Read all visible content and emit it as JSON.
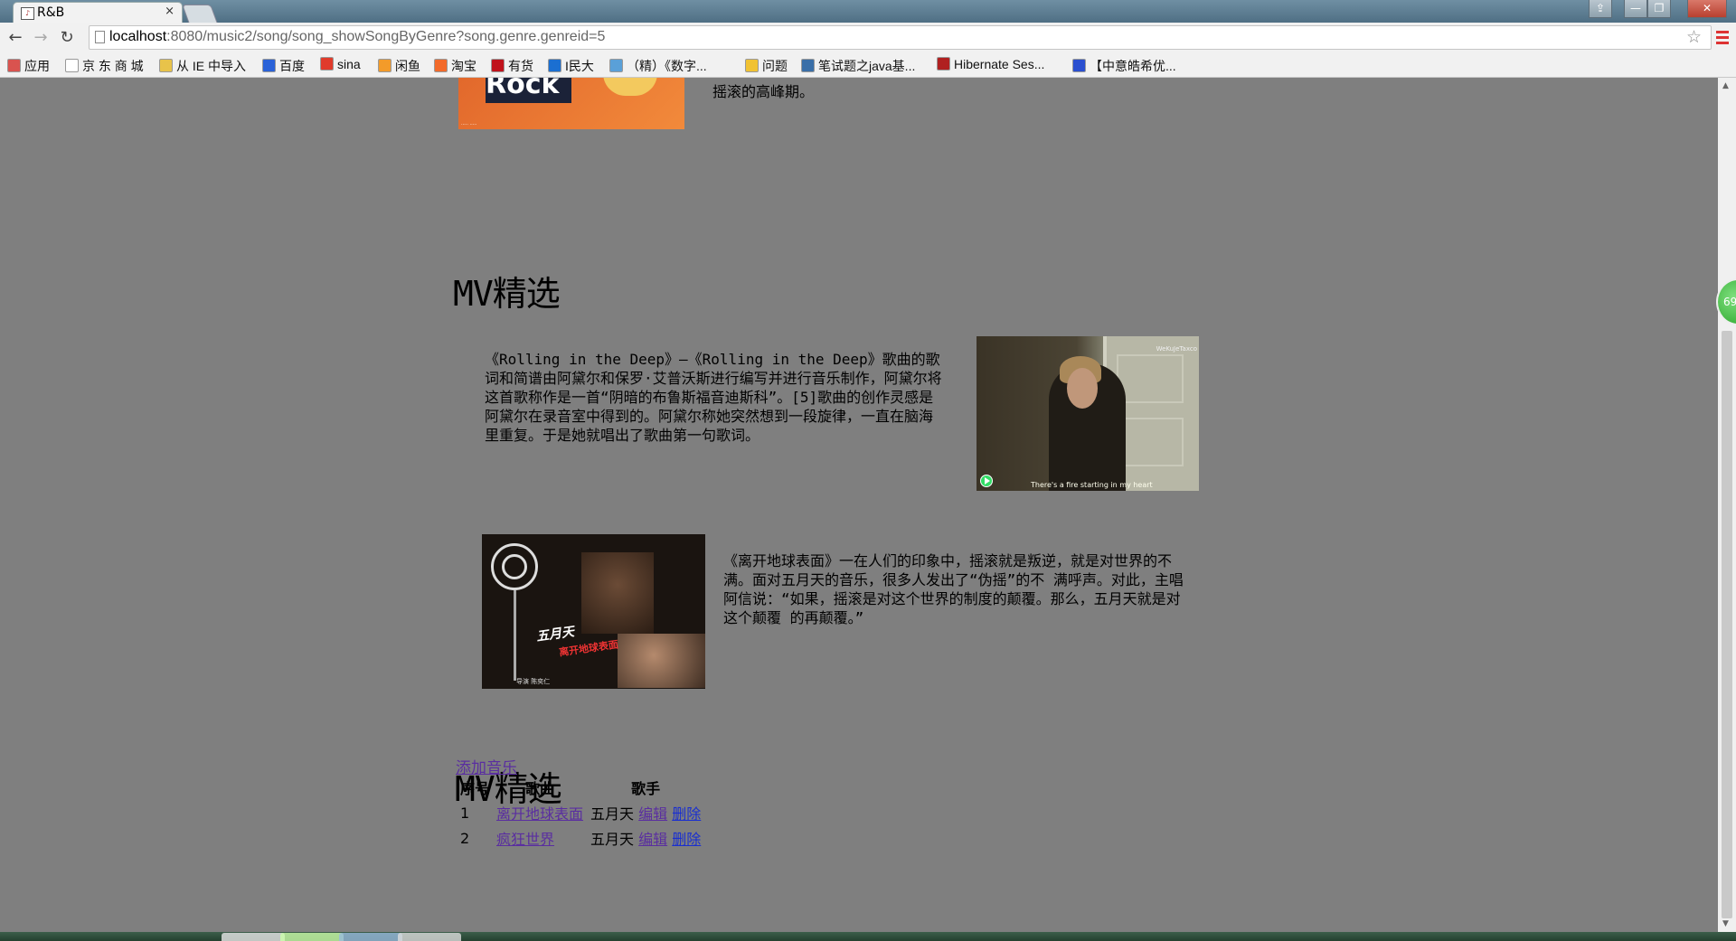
{
  "browser": {
    "tab_title": "R&B",
    "tab_close": "×",
    "url_host": "localhost",
    "url_rest": ":8080/music2/song/song_showSongByGenre?song.genre.genreid=5",
    "back": "←",
    "forward": "→",
    "reload": "↻",
    "star": "☆",
    "win_buttons": [
      "⇪",
      "—",
      "❐",
      "✕"
    ]
  },
  "bookmarks": [
    {
      "label": "应用",
      "icon": "apps-icon",
      "color": "#d9534f"
    },
    {
      "label": "京 东 商 城",
      "icon": "page-icon",
      "color": "#ffffff"
    },
    {
      "label": "从 IE 中导入",
      "icon": "folder-icon",
      "color": "#e8c34a"
    },
    {
      "label": "百度",
      "icon": "baidu-icon",
      "color": "#2a62d8"
    },
    {
      "label": "sina",
      "icon": "weibo-icon",
      "color": "#e03b2b"
    },
    {
      "label": "闲鱼",
      "icon": "xianyu-icon",
      "color": "#f39b2a"
    },
    {
      "label": "淘宝",
      "icon": "taobao-icon",
      "color": "#f36a2a"
    },
    {
      "label": "有货",
      "icon": "yohobuy-icon",
      "color": "#c0121b"
    },
    {
      "label": "I民大",
      "icon": "info-icon",
      "color": "#1b6fd1"
    },
    {
      "label": "（精）《数字...",
      "icon": "doc-icon",
      "color": "#5aa0d8"
    },
    {
      "label": "问题",
      "icon": "question-icon",
      "color": "#f1c232"
    },
    {
      "label": "笔试题之java基...",
      "icon": "compass-icon",
      "color": "#3a6fa8"
    },
    {
      "label": "Hibernate Ses...",
      "icon": "hibernate-icon",
      "color": "#b02020"
    },
    {
      "label": "【中意皓希优...",
      "icon": "paw-icon",
      "color": "#2a4fd0"
    }
  ],
  "top_snippet": {
    "line1": "",
    "line2": "摇滚的高峰期。",
    "poster_text": "Rock"
  },
  "section1": {
    "title": "MV精选",
    "mv1": {
      "description": "《Rolling in the Deep》—《Rolling in the Deep》歌曲的歌词和简谱由阿黛尔和保罗·艾普沃斯进行编写并进行音乐制作，阿黛尔将这首歌称作是一首“阴暗的布鲁斯福音迪斯科”。[5]歌曲的创作灵感是阿黛尔在录音室中得到的。阿黛尔称她突然想到一段旋律，一直在脑海里重复。于是她就唱出了歌曲第一句歌词。",
      "watermark": "WeKuJeTaxco",
      "subtitle": "There's a fire starting in my heart"
    },
    "mv2": {
      "description": "《离开地球表面》一在人们的印象中，摇滚就是叛逆，就是对世界的不满。面对五月天的音乐，很多人发出了“伪摇”的不 满呼声。对此，主唱阿信说：“如果，摇滚是对这个世界的制度的颠覆。那么，五月天就是对这个颠覆 的再颠覆。”",
      "logo": "五月天",
      "logo_sub": "离开地球表面",
      "credit": "导演  陈奕仁"
    }
  },
  "section2": {
    "title": "MV精选",
    "add_link": "添加音乐",
    "columns": [
      "序号",
      "歌曲",
      "歌手"
    ],
    "rows": [
      {
        "no": "1",
        "song": "离开地球表面",
        "singer": "五月天",
        "edit": "编辑",
        "delete": "删除"
      },
      {
        "no": "2",
        "song": "疯狂世界",
        "singer": "五月天",
        "edit": "编辑",
        "delete": "删除"
      }
    ]
  },
  "badge": "69"
}
